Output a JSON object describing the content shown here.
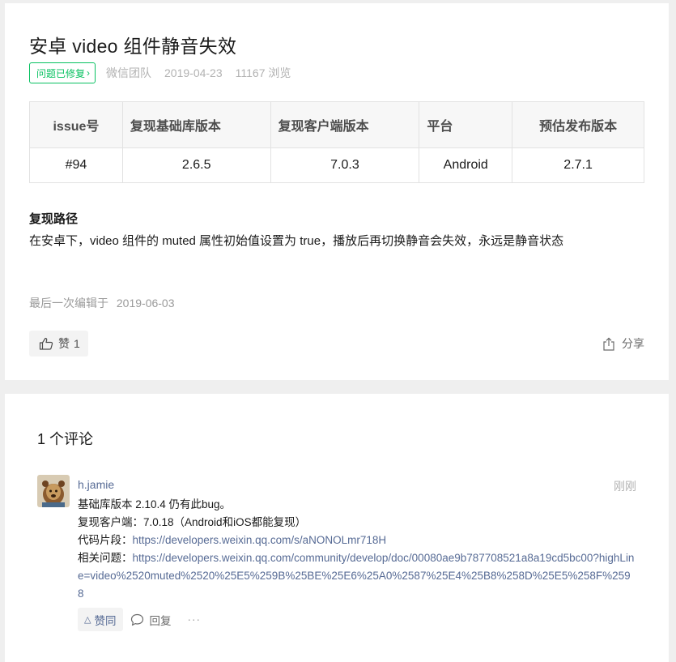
{
  "post": {
    "title": "安卓 video 组件静音失效",
    "status_label": "问题已修复",
    "author": "微信团队",
    "date": "2019-04-23",
    "views": "11167 浏览"
  },
  "table": {
    "headers": [
      "issue号",
      "复现基础库版本",
      "复现客户端版本",
      "平台",
      "预估发布版本"
    ],
    "row": [
      "#94",
      "2.6.5",
      "7.0.3",
      "Android",
      "2.7.1"
    ]
  },
  "repro": {
    "heading": "复现路径",
    "body": "在安卓下，video 组件的 muted 属性初始值设置为 true，播放后再切换静音会失效，永远是静音状态"
  },
  "edited": {
    "label": "最后一次编辑于",
    "date": "2019-06-03"
  },
  "actions": {
    "like_label": "赞",
    "like_count": "1",
    "share_label": "分享"
  },
  "comments": {
    "title": "1 个评论",
    "items": [
      {
        "user": "h.jamie",
        "time": "刚刚",
        "line1": "基础库版本 2.10.4 仍有此bug。",
        "line2": "复现客户端：7.0.18（Android和iOS都能复现）",
        "line3_label": "代码片段：",
        "line3_link": "https://developers.weixin.qq.com/s/aNONOLmr718H",
        "line4_label": "相关问题：",
        "line4_link": "https://developers.weixin.qq.com/community/develop/doc/00080ae9b787708521a8a19cd5bc00?highLine=video%2520muted%2520%25E5%259B%25BE%25E6%25A0%2587%25E4%25B8%258D%25E5%258F%2598",
        "agree_label": "赞同",
        "reply_label": "回复",
        "more_label": "···"
      }
    ]
  },
  "colors": {
    "accent_green": "#07c160",
    "link_blue": "#576b95"
  }
}
